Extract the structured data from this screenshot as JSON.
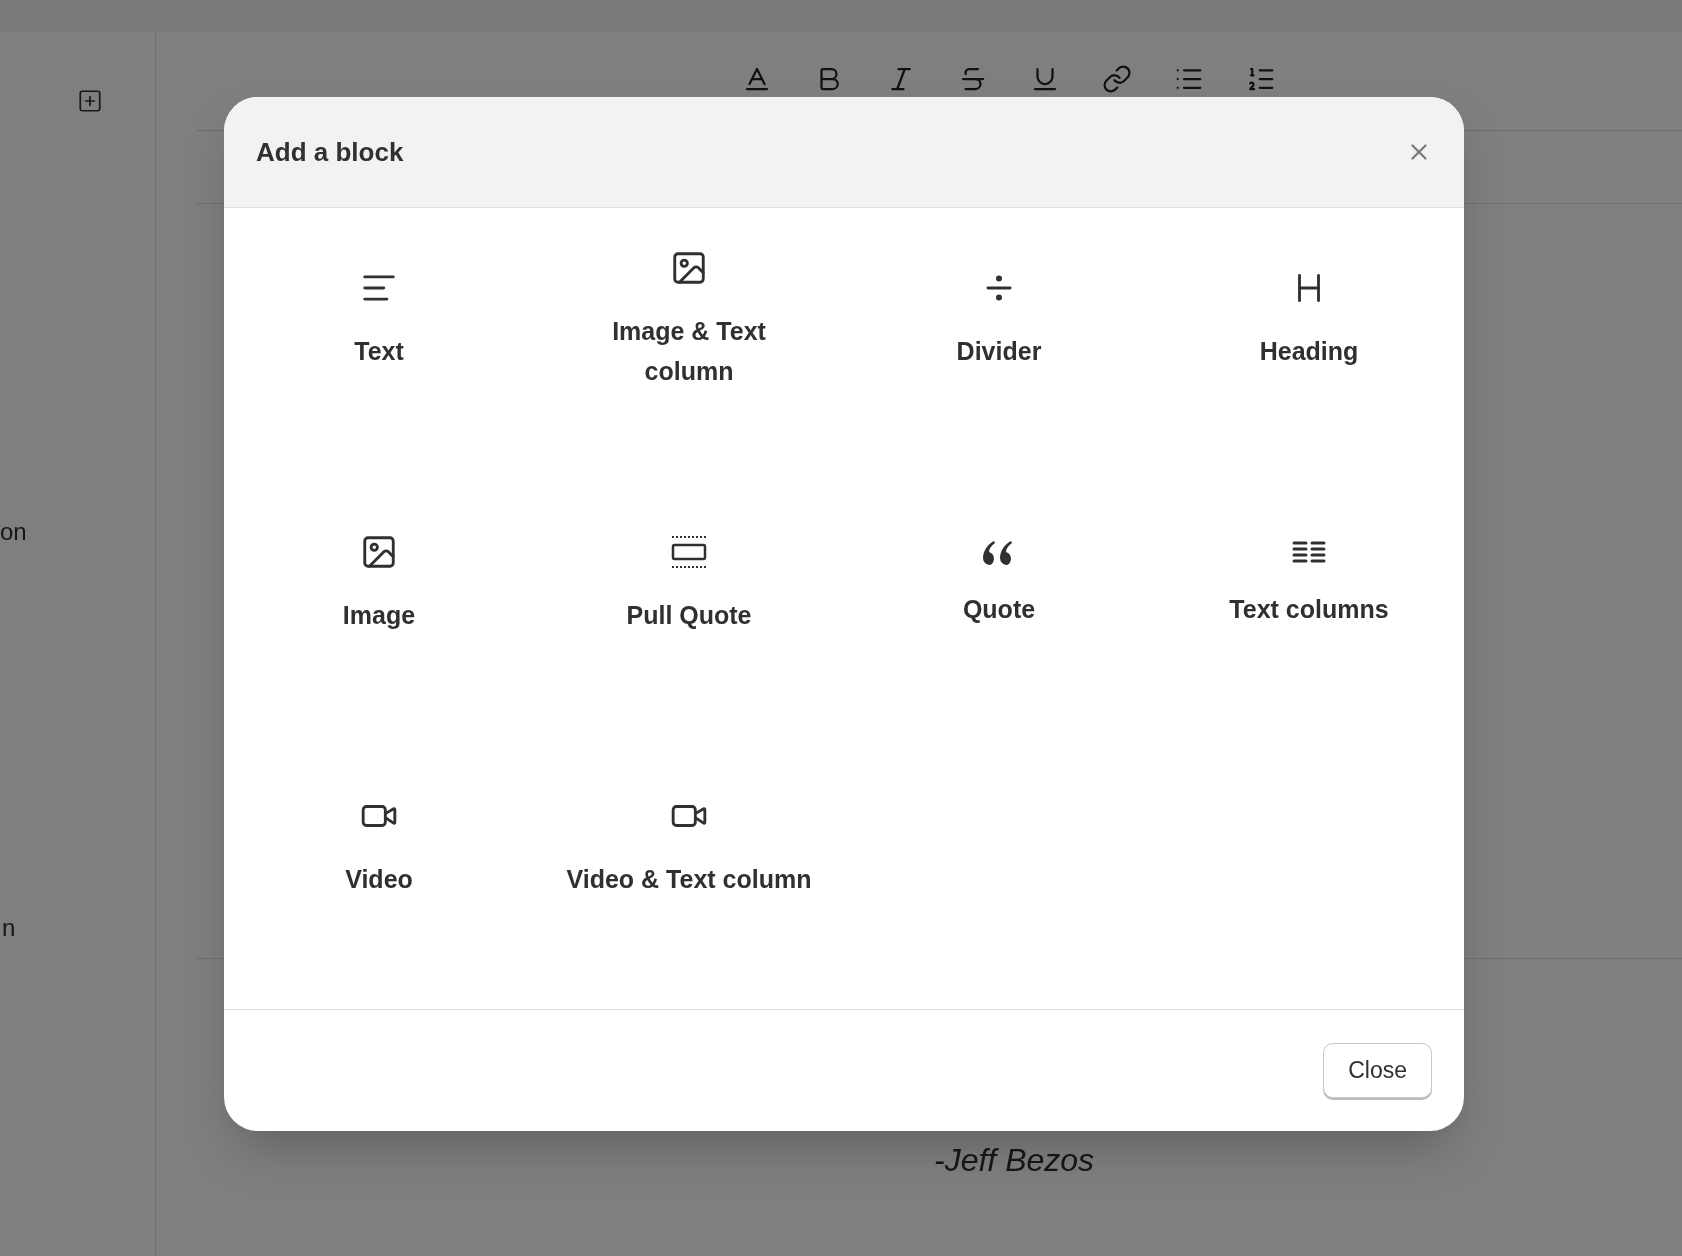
{
  "page": {
    "fragments": [
      {
        "kind": "side_one",
        "text": "on"
      },
      {
        "kind": "side_two",
        "text": "n"
      },
      {
        "kind": "quote_author",
        "text": "-Jeff Bezos"
      }
    ]
  },
  "dialog": {
    "title": "Add a block",
    "blocks": [
      {
        "kind": "text",
        "label": "Text"
      },
      {
        "kind": "image_text",
        "label": "Image & Text\ncolumn"
      },
      {
        "kind": "divider",
        "label": "Divider"
      },
      {
        "kind": "heading",
        "label": "Heading"
      },
      {
        "kind": "image",
        "label": "Image"
      },
      {
        "kind": "pull_quote",
        "label": "Pull Quote"
      },
      {
        "kind": "quote",
        "label": "Quote"
      },
      {
        "kind": "text_columns",
        "label": "Text columns"
      },
      {
        "kind": "video",
        "label": "Video"
      },
      {
        "kind": "video_text",
        "label": "Video & Text column"
      }
    ],
    "close_button": "Close"
  }
}
